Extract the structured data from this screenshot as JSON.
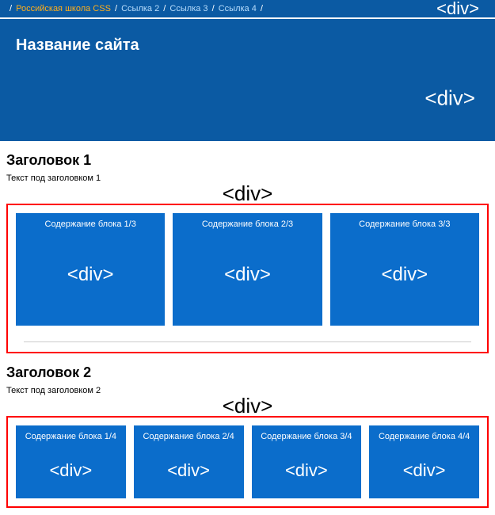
{
  "divTag": "<div>",
  "breadcrumb": {
    "items": [
      {
        "label": "Российская школа CSS"
      },
      {
        "label": "Ссылка 2"
      },
      {
        "label": "Ссылка 3"
      },
      {
        "label": "Ссылка 4"
      }
    ],
    "separator": "/"
  },
  "hero": {
    "title": "Название сайта"
  },
  "section1": {
    "heading": "Заголовок 1",
    "subtext": "Текст под заголовком 1",
    "blocks": [
      {
        "title": "Содержание блока 1/3"
      },
      {
        "title": "Содержание блока 2/3"
      },
      {
        "title": "Содержание блока 3/3"
      }
    ]
  },
  "section2": {
    "heading": "Заголовок 2",
    "subtext": "Текст под заголовком 2",
    "blocks": [
      {
        "title": "Содержание блока 1/4"
      },
      {
        "title": "Содержание блока 2/4"
      },
      {
        "title": "Содержание блока 3/4"
      },
      {
        "title": "Содержание блока 4/4"
      }
    ]
  }
}
